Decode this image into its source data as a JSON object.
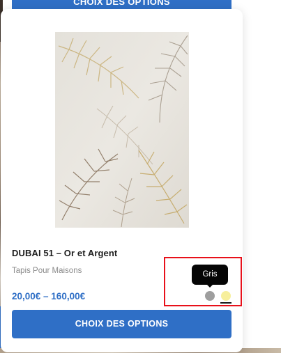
{
  "background": {
    "top_button_label": "CHOIX DES OPTIONS"
  },
  "product": {
    "title": "DUBAI 51 – Or et Argent",
    "category": "Tapis Pour Maisons",
    "price": "20,00€ – 160,00€",
    "image_icon": "rug-palm-leaves-image"
  },
  "swatches": [
    {
      "name": "Gris",
      "color": "#9e9e9e"
    },
    {
      "name": "Or",
      "color": "#f7ef9c"
    }
  ],
  "tooltip": {
    "label": "Gris"
  },
  "card_button": {
    "label": "CHOIX DES OPTIONS"
  },
  "colors": {
    "accent": "#2f6fc6",
    "highlight": "#e8101a",
    "tooltip_bg": "#050505"
  }
}
